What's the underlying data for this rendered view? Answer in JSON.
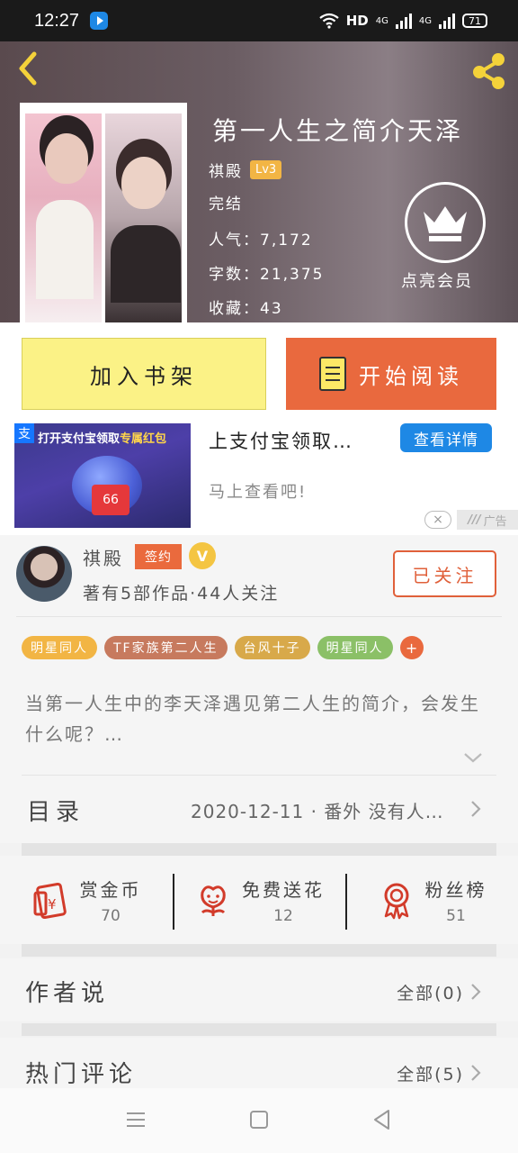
{
  "status_bar": {
    "time": "12:27",
    "network": "HD",
    "sim1": "4G",
    "sim2": "4G",
    "battery": "71"
  },
  "book": {
    "title": "第一人生之简介天泽",
    "author": "祺殿",
    "level": "Lv3",
    "status": "完结",
    "popularity_label": "人气：",
    "popularity": "7,172",
    "words_label": "字数：",
    "words": "21,375",
    "favorites_label": "收藏：",
    "favorites": "43"
  },
  "vip": {
    "label": "点亮会员"
  },
  "actions": {
    "add_shelf": "加入书架",
    "start_reading": "开始阅读"
  },
  "ad": {
    "image_text_prefix": "打开支付宝领取",
    "image_text_highlight": "专属红包",
    "image_amount": "66",
    "title": "上支付宝领取…",
    "button": "查看详情",
    "subtitle": "马上查看吧!",
    "close": "×",
    "tag": "广告"
  },
  "author_panel": {
    "name": "祺殿",
    "sign_badge": "签约",
    "v_badge": "V",
    "stats": "著有5部作品·44人关注",
    "follow_button": "已关注"
  },
  "tags": [
    {
      "label": "明星同人",
      "color": "#f2b544"
    },
    {
      "label": "TF家族第二人生",
      "color": "#c77a5e"
    },
    {
      "label": "台风十子",
      "color": "#d8a94a"
    },
    {
      "label": "明星同人",
      "color": "#8bc067"
    }
  ],
  "tag_more": "+",
  "description": "当第一人生中的李天泽遇见第二人生的简介，会发生什么呢？…",
  "toc": {
    "label": "目录",
    "latest": "2020-12-11 · 番外 没有人…"
  },
  "rewards": [
    {
      "label": "赏金币",
      "count": "70",
      "icon": "coin-icon"
    },
    {
      "label": "免费送花",
      "count": "12",
      "icon": "flower-icon"
    },
    {
      "label": "粉丝榜",
      "count": "51",
      "icon": "medal-icon"
    }
  ],
  "author_says": {
    "title": "作者说",
    "right": "全部(0)"
  },
  "hot_comments": {
    "title": "热门评论",
    "right": "全部(5)"
  },
  "colors": {
    "accent": "#e9693e",
    "shelf_button": "#fbf286",
    "ad_button": "#1e88e5"
  }
}
